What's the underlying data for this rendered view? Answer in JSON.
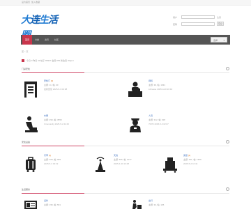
{
  "topbar": {
    "left_link": "设为首页",
    "right_link": "加入收藏"
  },
  "logo": {
    "chars": [
      "大",
      "连",
      "生",
      "活",
      "圈"
    ]
  },
  "login": {
    "user_label": "用户",
    "pass_label": "密码",
    "register": "注册",
    "forgot": "忘记",
    "submit": "登录"
  },
  "nav": {
    "items": [
      "首页",
      "分类",
      "资讯",
      "社区"
    ],
    "select_label": "选择"
  },
  "breadcrumb": {
    "home": "首",
    "sep": ">",
    "current": "页"
  },
  "stats": {
    "label_a": "今日",
    "value_a": "0",
    "label_b": "昨日",
    "value_b": "43",
    "label_c": "帖子",
    "value_c": "80937",
    "label_d": "会员",
    "value_d": "854",
    "label_e": "新会员",
    "value_e": "Object"
  },
  "sections": [
    {
      "title": "门禁安检",
      "items": [
        {
          "title": "安检门",
          "badge": "[4]",
          "meta": "主题: 11, 帖: 20",
          "date": "最新回复 2025-5-3 04:08",
          "icon": "metal-detector-gate-icon"
        },
        {
          "title": "闸机",
          "badge": "",
          "meta": "主题: 30, 帖: 1031",
          "date": "Libresse 2025-4-20 20:10",
          "icon": "desk-officer-icon"
        },
        {
          "title": "车辆",
          "badge": "",
          "meta": "主题: 290, 帖: 3550",
          "date": "Cinemacity 2025-5-2 22:40",
          "icon": "car-seat-icon"
        },
        {
          "title": "人员",
          "badge": "",
          "meta": "主题: 312, 帖: 918",
          "date": "7D7D 2025-5-3 02:07",
          "icon": "security-guard-icon"
        }
      ]
    },
    {
      "title": "安检设备",
      "items": [
        {
          "title": "行李",
          "badge": "[1]",
          "meta": "主题: 209, 帖: 909",
          "date": "2025-5-3 02:19",
          "icon": "luggage-icon"
        },
        {
          "title": "天线",
          "badge": "",
          "meta": "主题: 306, 帖: 1077",
          "date": "2025-4-30 10:48",
          "icon": "antenna-tower-icon"
        },
        {
          "title": "通道",
          "badge": "[1]",
          "meta": "主题: 431, 帖: 1309",
          "date": "2025-5-2 10:44",
          "icon": "xray-scanner-icon"
        }
      ]
    },
    {
      "title": "生活服务",
      "items": [
        {
          "title": "证件",
          "badge": "",
          "meta": "主题: 195, 帖: 591",
          "date": "",
          "icon": "id-card-icon"
        },
        {
          "title": "出行",
          "badge": "",
          "meta": "主题: 34, 帖: 125",
          "date": "",
          "icon": "traveler-icon"
        }
      ]
    }
  ],
  "colors": {
    "accent": "#c9364c",
    "nav": "#555555",
    "logo": "#1e7ad2",
    "link": "#3a6ec0"
  }
}
